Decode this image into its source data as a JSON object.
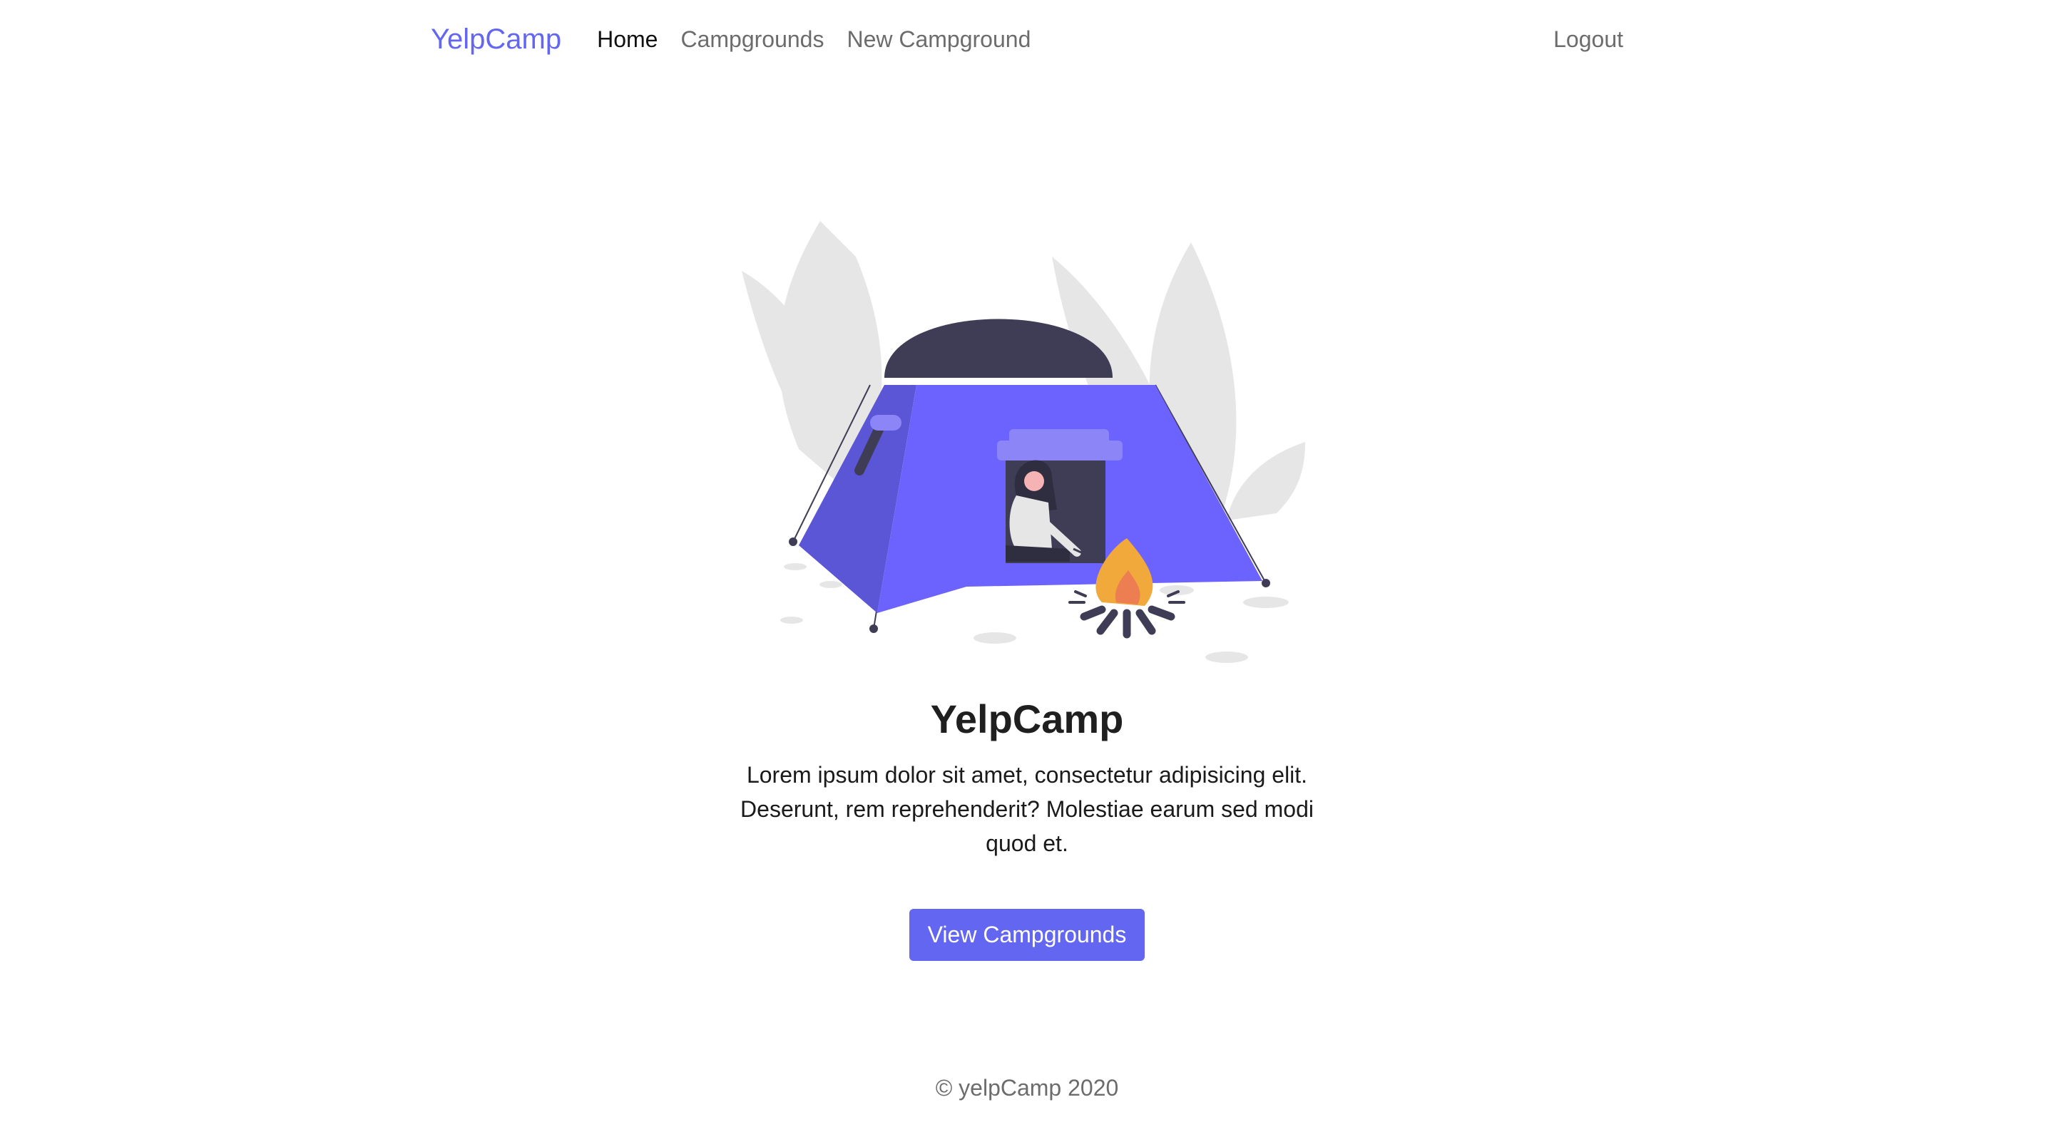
{
  "navbar": {
    "brand": "YelpCamp",
    "links": [
      {
        "label": "Home",
        "active": true
      },
      {
        "label": "Campgrounds",
        "active": false
      },
      {
        "label": "New Campground",
        "active": false
      }
    ],
    "logout": "Logout"
  },
  "hero": {
    "illustration_icon": "camping-tent-campfire-illustration",
    "title": "YelpCamp",
    "description": "Lorem ipsum dolor sit amet, consectetur adipisicing elit. Deserunt, rem reprehenderit? Molestiae earum sed modi quod et.",
    "button_label": "View Campgrounds"
  },
  "footer": {
    "text": "© yelpCamp 2020"
  },
  "colors": {
    "accent": "#6366f1",
    "tent_top": "#3f3d56",
    "foliage": "#e6e6e6",
    "fire": "#f0a93a"
  }
}
